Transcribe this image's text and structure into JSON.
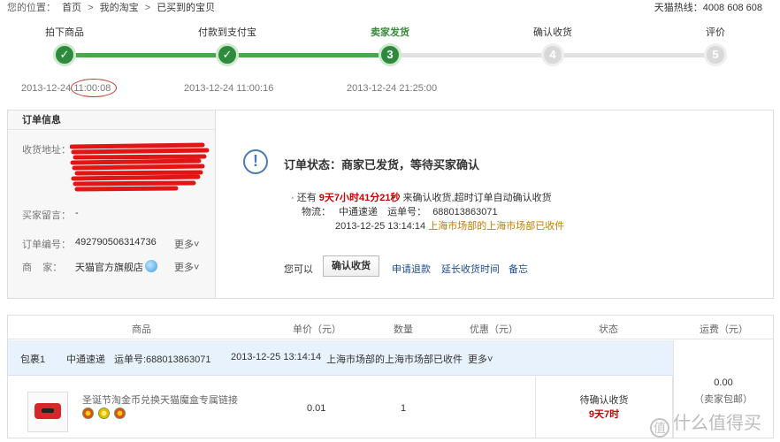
{
  "breadcrumb": {
    "prefix": "您的位置：",
    "items": [
      "首页",
      "我的淘宝",
      "已买到的宝贝"
    ],
    "separator": ">"
  },
  "hotline": "天猫热线：4008 608 608",
  "progress": {
    "steps": [
      {
        "label": "拍下商品",
        "state": "done",
        "mark": "✓",
        "time": "2013-12-24 11:00:08"
      },
      {
        "label": "付款到支付宝",
        "state": "done",
        "mark": "✓",
        "time": "2013-12-24 11:00:16"
      },
      {
        "label": "卖家发货",
        "state": "current",
        "mark": "3",
        "time": "2013-12-24 21:25:00"
      },
      {
        "label": "确认收货",
        "state": "todo",
        "mark": "4",
        "time": ""
      },
      {
        "label": "评价",
        "state": "todo",
        "mark": "5",
        "time": ""
      }
    ],
    "colors": {
      "done": "#2e8b3e",
      "todo": "#d9d9d9"
    }
  },
  "order_info": {
    "title": "订单信息",
    "address_label": "收货地址：",
    "message_label": "买家留言：",
    "message_value": "-",
    "order_no_label": "订单编号：",
    "order_no": "492790506314736",
    "more1": "更多",
    "seller_label": "商    家：",
    "seller": "天猫官方旗舰店",
    "more2": "更多"
  },
  "status": {
    "title": "订单状态：商家已发货，等待买家确认",
    "prefix": "· 还有 ",
    "remaining": "9天7小时41分21秒",
    "suffix": " 来确认收货,超时订单自动确认收货",
    "logistics_label": "物流：",
    "carrier": "中通速递",
    "waybill_label": "运单号：",
    "waybill": "688013863071",
    "track_time": "2013-12-25 13:14:14",
    "track_msg": "上海市场部的上海市场部已收件",
    "actions_label": "您可以",
    "confirm_button": "确认收货",
    "refund": "申请退款",
    "extend": "延长收货时间",
    "note": "备忘"
  },
  "table": {
    "headers": [
      "商品",
      "单价（元）",
      "数量",
      "优惠（元）",
      "状态",
      "运费（元）"
    ],
    "package": {
      "name": "包裹1",
      "carrier": "中通速递",
      "waybill": "运单号:688013863071",
      "time": "2013-12-25 13:14:14",
      "msg": "上海市场部的上海市场部已收件",
      "more": "更多"
    },
    "item": {
      "name": "圣诞节淘金币兑换天猫魔盒专属链接",
      "price": "0.01",
      "qty": "1",
      "status": "待确认收货",
      "countdown": "9天7时"
    },
    "shipping": "0.00",
    "shipping_note": "（卖家包邮）"
  },
  "watermark": "什么值得买"
}
